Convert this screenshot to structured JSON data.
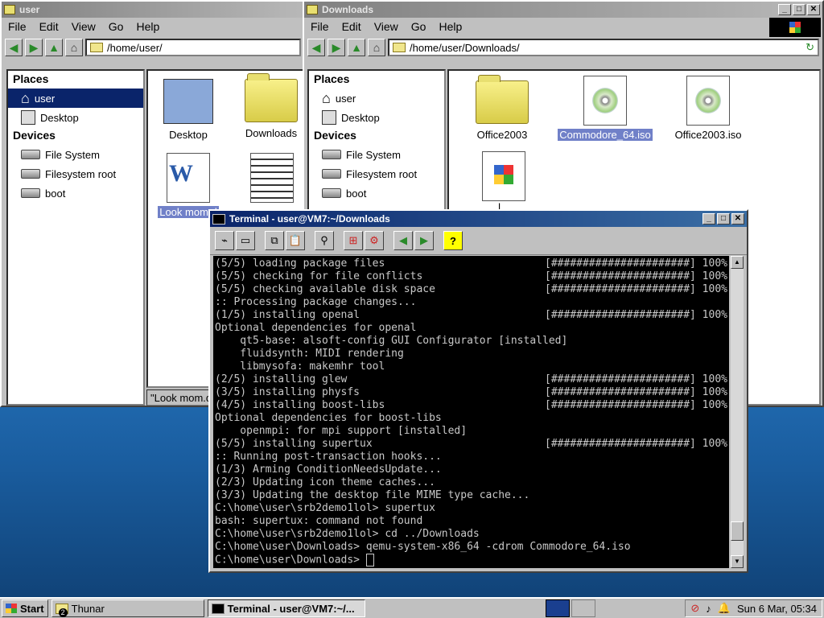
{
  "left_window": {
    "title": "user",
    "menu": [
      "File",
      "Edit",
      "View",
      "Go",
      "Help"
    ],
    "path": "/home/user/",
    "places_header": "Places",
    "places": [
      "user",
      "Desktop"
    ],
    "devices_header": "Devices",
    "devices": [
      "File System",
      "Filesystem root",
      "boot"
    ],
    "files": [
      "Desktop",
      "Downloads",
      "Look mom.d",
      ""
    ],
    "status": "\"Look mom.d"
  },
  "right_window": {
    "title": "Downloads",
    "menu": [
      "File",
      "Edit",
      "View",
      "Go",
      "Help"
    ],
    "path": "/home/user/Downloads/",
    "places_header": "Places",
    "places": [
      "user",
      "Desktop"
    ],
    "devices_header": "Devices",
    "devices": [
      "File System",
      "Filesystem root",
      "boot"
    ],
    "files": [
      "Office2003",
      "Commodore_64.iso",
      "Office2003.iso",
      "l..."
    ]
  },
  "terminal": {
    "title": "Terminal - user@VM7:~/Downloads",
    "lines": [
      {
        "l": "(5/5) loading package files",
        "r": "[######################] 100%"
      },
      {
        "l": "(5/5) checking for file conflicts",
        "r": "[######################] 100%"
      },
      {
        "l": "(5/5) checking available disk space",
        "r": "[######################] 100%"
      },
      {
        "l": ":: Processing package changes...",
        "r": ""
      },
      {
        "l": "(1/5) installing openal",
        "r": "[######################] 100%"
      },
      {
        "l": "Optional dependencies for openal",
        "r": ""
      },
      {
        "l": "    qt5-base: alsoft-config GUI Configurator [installed]",
        "r": ""
      },
      {
        "l": "    fluidsynth: MIDI rendering",
        "r": ""
      },
      {
        "l": "    libmysofa: makemhr tool",
        "r": ""
      },
      {
        "l": "(2/5) installing glew",
        "r": "[######################] 100%"
      },
      {
        "l": "(3/5) installing physfs",
        "r": "[######################] 100%"
      },
      {
        "l": "(4/5) installing boost-libs",
        "r": "[######################] 100%"
      },
      {
        "l": "Optional dependencies for boost-libs",
        "r": ""
      },
      {
        "l": "    openmpi: for mpi support [installed]",
        "r": ""
      },
      {
        "l": "(5/5) installing supertux",
        "r": "[######################] 100%"
      },
      {
        "l": ":: Running post-transaction hooks...",
        "r": ""
      },
      {
        "l": "(1/3) Arming ConditionNeedsUpdate...",
        "r": ""
      },
      {
        "l": "(2/3) Updating icon theme caches...",
        "r": ""
      },
      {
        "l": "(3/3) Updating the desktop file MIME type cache...",
        "r": ""
      },
      {
        "l": "C:\\home\\user\\srb2demo1lol> supertux",
        "r": ""
      },
      {
        "l": "bash: supertux: command not found",
        "r": ""
      },
      {
        "l": "C:\\home\\user\\srb2demo1lol> cd ../Downloads",
        "r": ""
      },
      {
        "l": "C:\\home\\user\\Downloads> qemu-system-x86_64 -cdrom Commodore_64.iso",
        "r": ""
      },
      {
        "l": "C:\\home\\user\\Downloads> ",
        "r": ""
      }
    ]
  },
  "taskbar": {
    "start": "Start",
    "items": [
      "Thunar",
      "Terminal - user@VM7:~/..."
    ],
    "badge": "2",
    "clock": "Sun 6 Mar, 05:34"
  }
}
